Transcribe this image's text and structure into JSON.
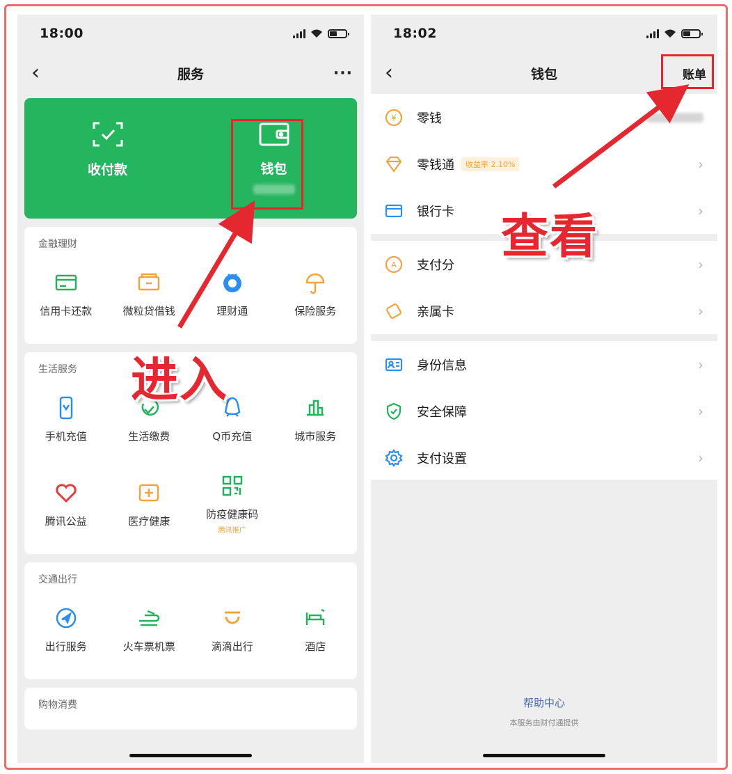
{
  "left_phone": {
    "status": {
      "time": "18:00"
    },
    "nav": {
      "back": "‹",
      "title": "服务",
      "more": "···"
    },
    "top_card": {
      "items": [
        {
          "label": "收付款",
          "icon": "scan-check-icon"
        },
        {
          "label": "钱包",
          "icon": "wallet-icon"
        }
      ]
    },
    "sections": [
      {
        "title": "金融理财",
        "items": [
          {
            "label": "信用卡还款",
            "icon": "credit-card-icon",
            "color": "#21b35c"
          },
          {
            "label": "微粒贷借钱",
            "icon": "loan-icon",
            "color": "#f0a43a"
          },
          {
            "label": "理财通",
            "icon": "wealth-icon",
            "color": "#2d8ef0"
          },
          {
            "label": "保险服务",
            "icon": "umbrella-icon",
            "color": "#f0a43a"
          }
        ]
      },
      {
        "title": "生活服务",
        "items": [
          {
            "label": "手机充值",
            "icon": "phone-icon",
            "color": "#2d8ef0"
          },
          {
            "label": "生活缴费",
            "icon": "bill-icon",
            "color": "#21b35c"
          },
          {
            "label": "Q币充值",
            "icon": "penguin-icon",
            "color": "#2d8ef0"
          },
          {
            "label": "城市服务",
            "icon": "city-icon",
            "color": "#21b35c"
          },
          {
            "label": "腾讯公益",
            "icon": "heart-icon",
            "color": "#e53b3b"
          },
          {
            "label": "医疗健康",
            "icon": "medical-icon",
            "color": "#f0a43a"
          },
          {
            "label": "防疫健康码",
            "icon": "qrcode-icon",
            "color": "#21b35c",
            "sub": "腾讯推广"
          }
        ]
      },
      {
        "title": "交通出行",
        "items": [
          {
            "label": "出行服务",
            "icon": "navigation-icon",
            "color": "#2d8ef0"
          },
          {
            "label": "火车票机票",
            "icon": "train-icon",
            "color": "#21b35c"
          },
          {
            "label": "滴滴出行",
            "icon": "didi-icon",
            "color": "#f0a43a"
          },
          {
            "label": "酒店",
            "icon": "bed-icon",
            "color": "#21b35c"
          }
        ]
      },
      {
        "title": "购物消费",
        "items": []
      }
    ]
  },
  "right_phone": {
    "status": {
      "time": "18:02"
    },
    "nav": {
      "back": "‹",
      "title": "钱包",
      "right": "账单"
    },
    "groups": [
      [
        {
          "label": "零钱",
          "icon": "coin-icon",
          "color": "#f0a43a",
          "blurred_amount": true
        },
        {
          "label": "零钱通",
          "icon": "diamond-icon",
          "color": "#f0a43a",
          "badge": "收益率 2.10%"
        },
        {
          "label": "银行卡",
          "icon": "bank-card-icon",
          "color": "#2d8ef0"
        }
      ],
      [
        {
          "label": "支付分",
          "icon": "score-icon",
          "color": "#f0a43a"
        },
        {
          "label": "亲属卡",
          "icon": "family-card-icon",
          "color": "#f0a43a"
        }
      ],
      [
        {
          "label": "身份信息",
          "icon": "id-card-icon",
          "color": "#2d8ef0"
        },
        {
          "label": "安全保障",
          "icon": "shield-icon",
          "color": "#21b35c"
        },
        {
          "label": "支付设置",
          "icon": "gear-icon",
          "color": "#2d8ef0"
        }
      ]
    ],
    "footer": {
      "help": "帮助中心",
      "note": "本服务由财付通提供"
    }
  },
  "annotations": {
    "enter": "进入",
    "view": "查看",
    "color": "#e52730"
  },
  "colors": {
    "brand_green": "#25b55e",
    "highlight_red": "#e6262a"
  }
}
